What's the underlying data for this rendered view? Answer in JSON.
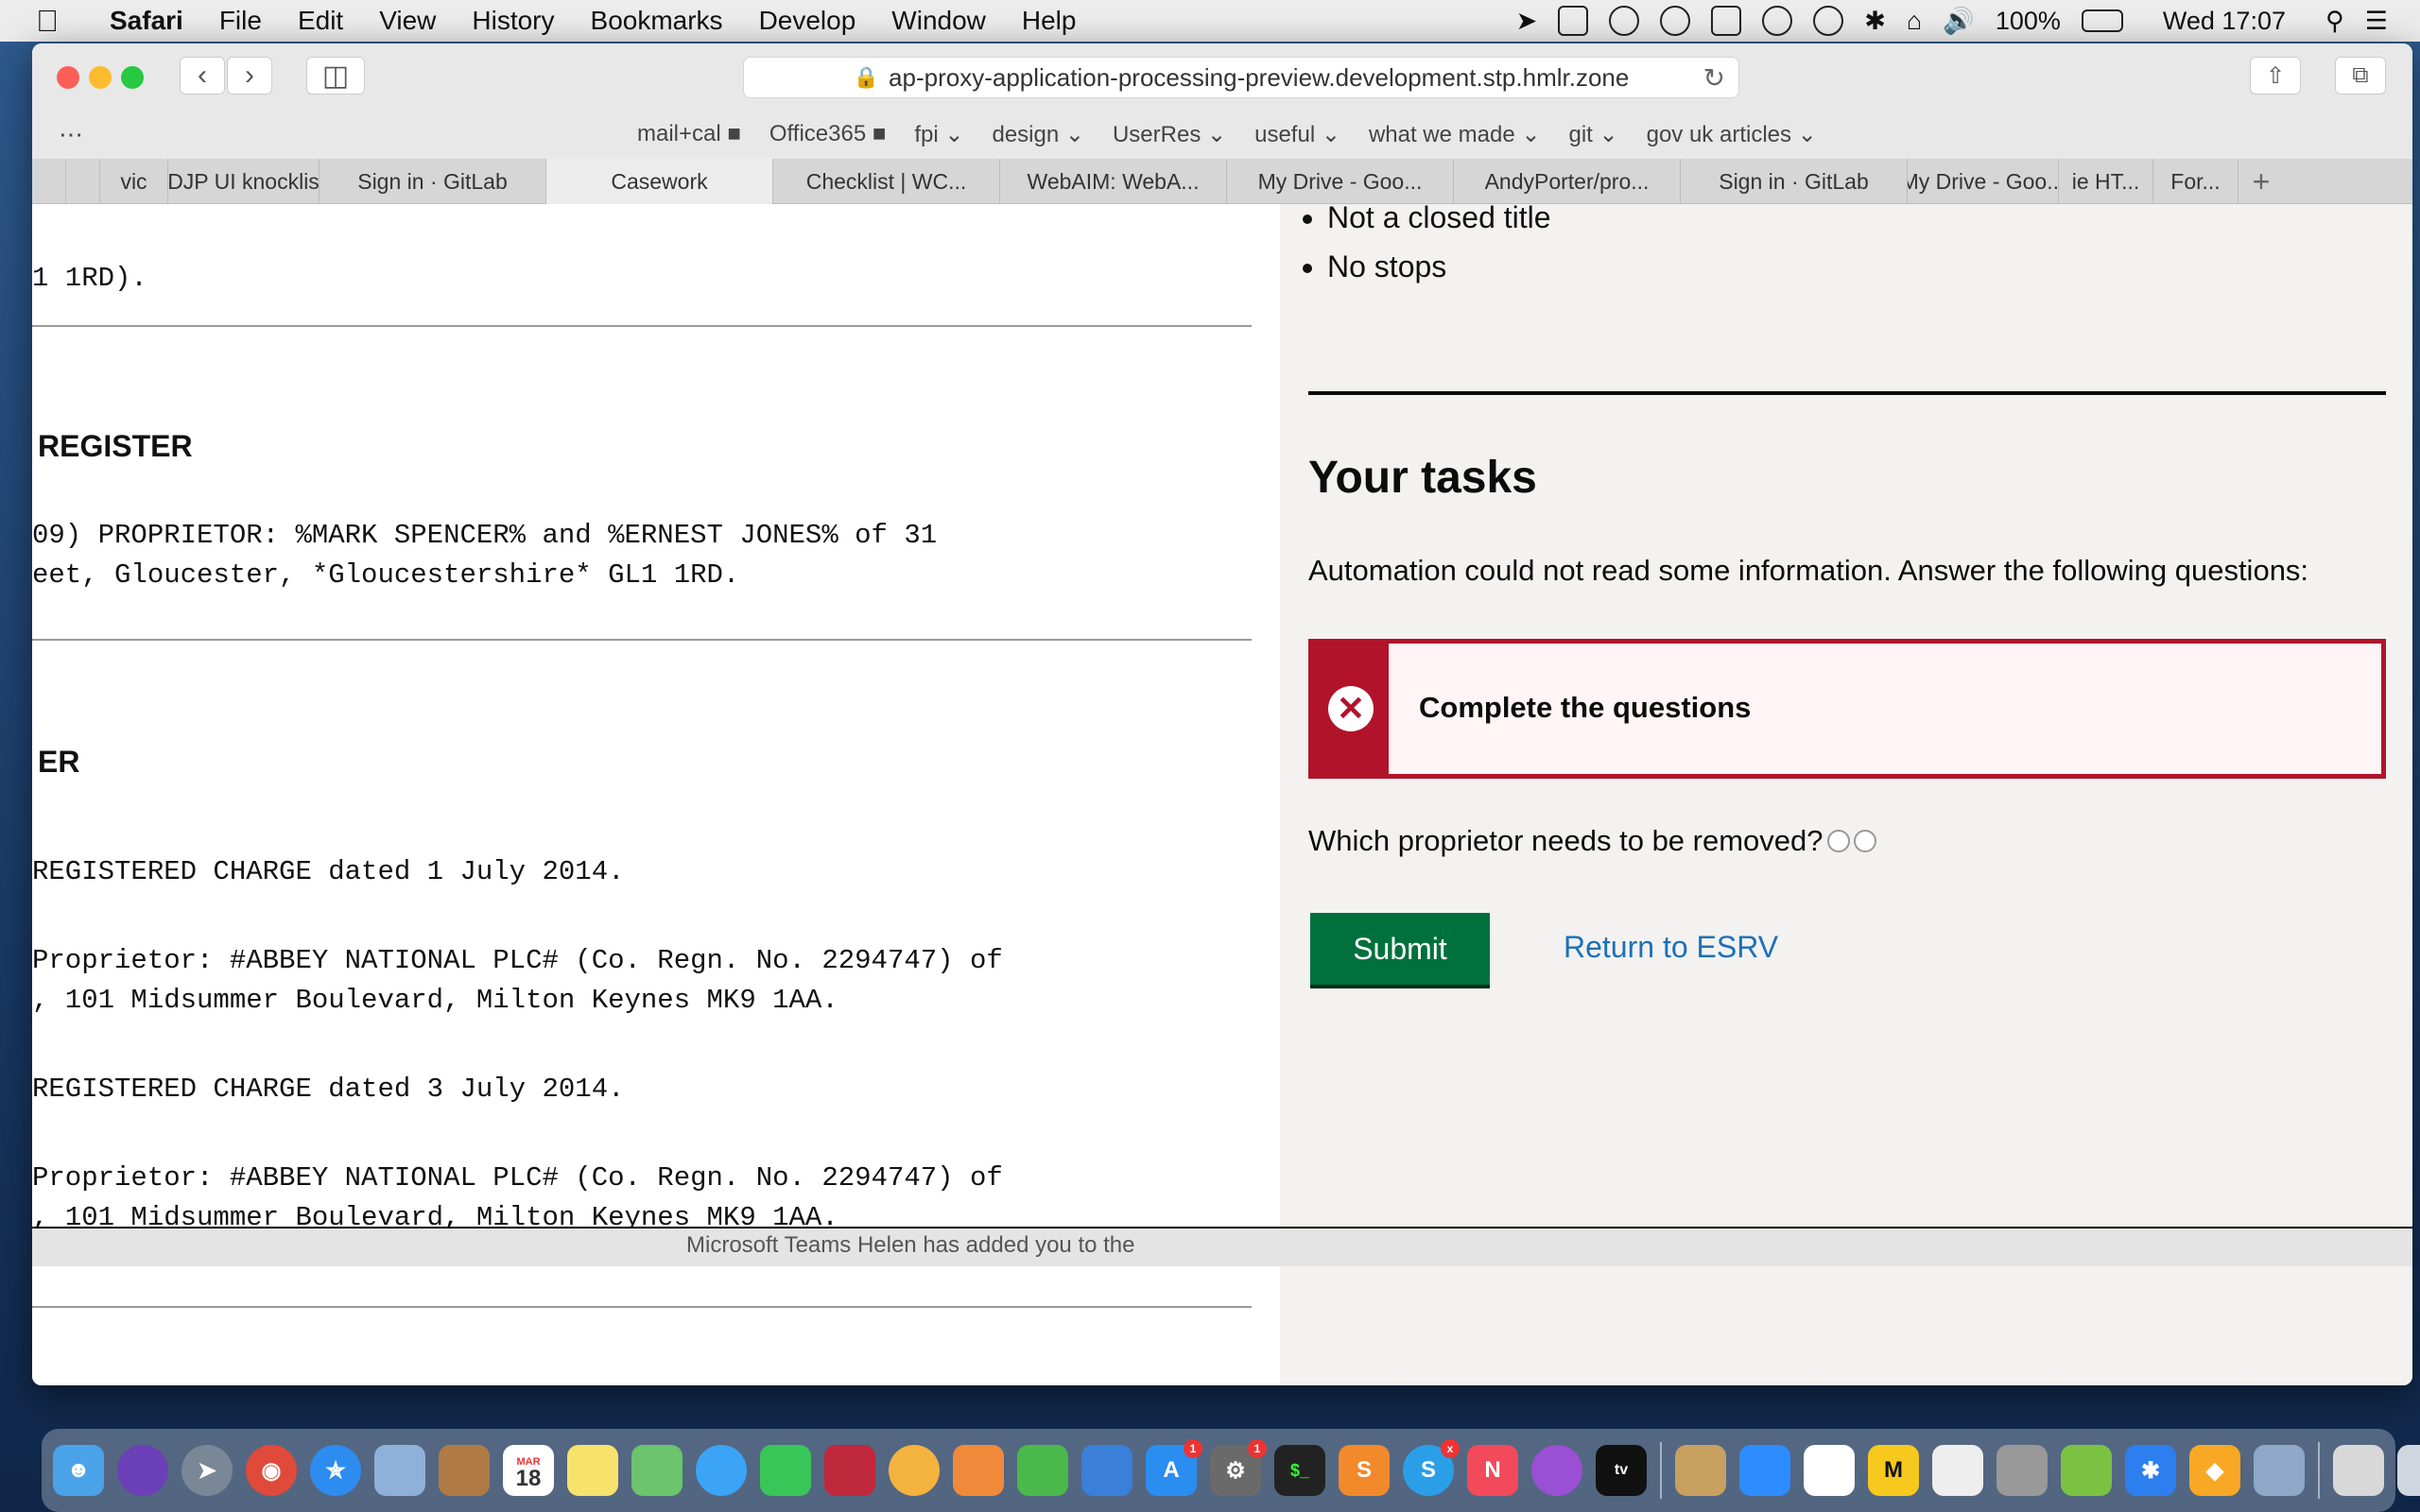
{
  "menubar": {
    "app_name": "Safari",
    "items": [
      "File",
      "Edit",
      "View",
      "History",
      "Bookmarks",
      "Develop",
      "Window",
      "Help"
    ],
    "battery": "100%",
    "clock": "Wed 17:07"
  },
  "browser": {
    "url": "ap-proxy-application-processing-preview.development.stp.hmlr.zone",
    "favorites": [
      "mail+cal ■",
      "Office365 ■",
      "fpi ⌄",
      "design ⌄",
      "UserRes ⌄",
      "useful ⌄",
      "what we made ⌄",
      "git ⌄",
      "gov uk articles ⌄"
    ],
    "tabs": [
      "vic",
      "DJP UI knocklis",
      "Sign in · GitLab",
      "Casework",
      "Checklist | WC...",
      "WebAIM: WebA...",
      "My Drive - Goo...",
      "AndyPorter/pro...",
      "Sign in · GitLab",
      "My Drive - Goo...",
      "ie HT...",
      "For..."
    ],
    "active_tab_index": 3
  },
  "register": {
    "line_top": "1 1RD).",
    "proprietorship_heading": "REGISTER",
    "proprietor_line_1": "09) PROPRIETOR: %MARK SPENCER% and %ERNEST JONES% of 31",
    "proprietor_line_2": "eet, Gloucester, *Gloucestershire* GL1 1RD.",
    "charges_heading": "ER",
    "charge_1": "REGISTERED CHARGE dated 1 July 2014.",
    "charge_1_prop_1": "Proprietor: #ABBEY NATIONAL PLC# (Co. Regn. No. 2294747) of",
    "charge_1_prop_2": ", 101 Midsummer Boulevard, Milton Keynes MK9 1AA.",
    "charge_2": "REGISTERED CHARGE dated 3 July 2014.",
    "charge_2_prop_1": "Proprietor: #ABBEY NATIONAL PLC# (Co. Regn. No. 2294747) of",
    "charge_2_prop_2": ", 101 Midsummer Boulevard, Milton Keynes MK9 1AA."
  },
  "tasks": {
    "bullets": [
      "Not a closed title",
      "No stops"
    ],
    "heading": "Your tasks",
    "intro": "Automation could not read some information. Answer the following questions:",
    "error_title": "Complete the questions",
    "question": "Which proprietor needs to be removed?",
    "submit_label": "Submit",
    "return_link": "Return to ESRV"
  },
  "notification_text": "Microsoft Teams  Helen has added you to the",
  "colors": {
    "error_red": "#b1132a",
    "submit_green": "#00703c",
    "link_blue": "#1d70b8"
  },
  "dock": {
    "calendar_month": "MAR",
    "calendar_day": "18",
    "badges": [
      "1",
      "1",
      "x"
    ]
  }
}
